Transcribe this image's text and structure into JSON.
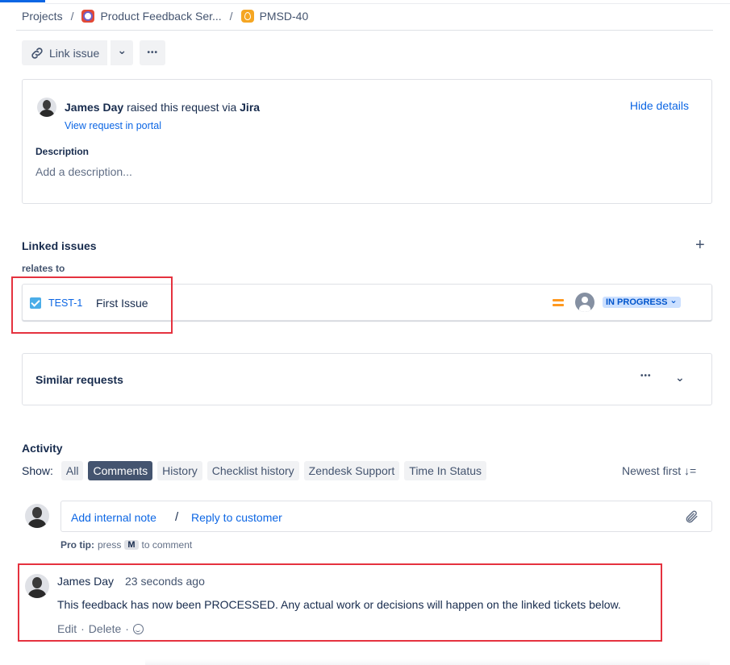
{
  "breadcrumb": {
    "projects": "Projects",
    "sep1": "/",
    "project": "Product Feedback Ser...",
    "sep2": "/",
    "issue": "PMSD-40"
  },
  "toolbar": {
    "link_issue": "Link issue",
    "caret": "⌄",
    "more": "•••"
  },
  "request": {
    "reporter": "James Day",
    "raised_text": "raised this request via",
    "channel": "Jira",
    "portal_link": "View request in portal",
    "hide_details": "Hide details",
    "description_label": "Description",
    "description_placeholder": "Add a description..."
  },
  "linked": {
    "title": "Linked issues",
    "add": "+",
    "relation": "relates to",
    "issue_key": "TEST-1",
    "issue_summary": "First Issue",
    "status": "IN PROGRESS",
    "status_caret": "⌄"
  },
  "similar": {
    "title": "Similar requests",
    "more": "•••",
    "chevron": "⌄"
  },
  "activity": {
    "title": "Activity",
    "show_label": "Show:",
    "filters": [
      "All",
      "Comments",
      "History",
      "Checklist history",
      "Zendesk Support",
      "Time In Status"
    ],
    "active_filter": "Comments",
    "sort": "Newest first ↓="
  },
  "composer": {
    "add_note": "Add internal note",
    "slash": "/",
    "reply": "Reply to customer",
    "pro_tip_label": "Pro tip:",
    "pro_tip_press": "press",
    "pro_tip_key": "M",
    "pro_tip_suffix": "to comment"
  },
  "comment": {
    "author": "James Day",
    "time": "23 seconds ago",
    "body": "This feedback has now been PROCESSED. Any actual work or decisions will happen on the linked tickets below.",
    "edit": "Edit",
    "dot1": "·",
    "delete": "Delete",
    "dot2": "·"
  },
  "colors": {
    "accent": "#0c66e4",
    "highlight_box": "#e5323f",
    "status_bg": "#cce0ff"
  }
}
